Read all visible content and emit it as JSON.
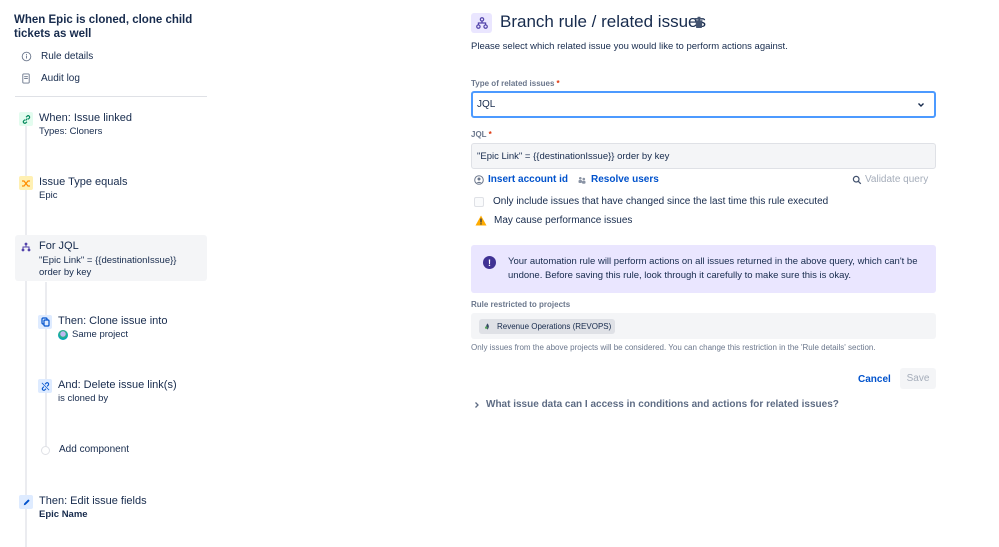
{
  "sidebar": {
    "rule_title": "When Epic is cloned, clone child tickets as well",
    "nav": [
      {
        "label": "Rule details",
        "icon": "info-icon"
      },
      {
        "label": "Audit log",
        "icon": "document-icon"
      }
    ],
    "steps": [
      {
        "title": "When: Issue linked",
        "subtitle": "Types: Cloners",
        "icon": "link-icon",
        "color": "#e3fcef"
      },
      {
        "title": "Issue Type equals",
        "subtitle": "Epic",
        "icon": "shuffle-icon",
        "color": "#fff0b3"
      },
      {
        "title": "For JQL",
        "subtitle": "\"Epic Link\" = {{destinationIssue}}",
        "subtitle2": "order by key",
        "icon": "branch-icon",
        "color": "#eae6ff",
        "selected": true
      },
      {
        "title": "Then: Clone issue into",
        "subtitle": "Same project",
        "icon": "copy-icon",
        "color": "#deebff"
      },
      {
        "title": "And: Delete issue link(s)",
        "subtitle": "is cloned by",
        "icon": "unlink-icon",
        "color": "#deebff"
      },
      {
        "title": "Add component"
      },
      {
        "title": "Then: Edit issue fields",
        "subtitle": "Epic Name",
        "icon": "pencil-icon",
        "color": "#deebff"
      }
    ]
  },
  "panel": {
    "title": "Branch rule / related issues",
    "description": "Please select which related issue you would like to perform actions against.",
    "type_label": "Type of related issues",
    "type_value": "JQL",
    "jql_label": "JQL",
    "jql_value": "\"Epic Link\" = {{destinationIssue}} order by key",
    "insert_account_id": "Insert account id",
    "resolve_users": "Resolve users",
    "validate_query": "Validate query",
    "checkbox_label": "Only include issues that have changed since the last time this rule executed",
    "checkbox_checked": false,
    "warning": "May cause performance issues",
    "info_message": "Your automation rule will perform actions on all issues returned in the above query, which can't be undone. Before saving this rule, look through it carefully to make sure this is okay.",
    "restricted_label": "Rule restricted to projects",
    "project": "Revenue Operations (REVOPS)",
    "restricted_help": "Only issues from the above projects will be considered. You can change this restriction in the 'Rule details' section.",
    "cancel": "Cancel",
    "save": "Save",
    "faq": "What issue data can I access in conditions and actions for related issues?"
  },
  "colors": {
    "link": "#0052cc",
    "focus_border": "#4c9aff",
    "info_bg": "#eae6ff",
    "info_icon": "#403294",
    "warning": "#ffab00",
    "required": "#de350b"
  }
}
